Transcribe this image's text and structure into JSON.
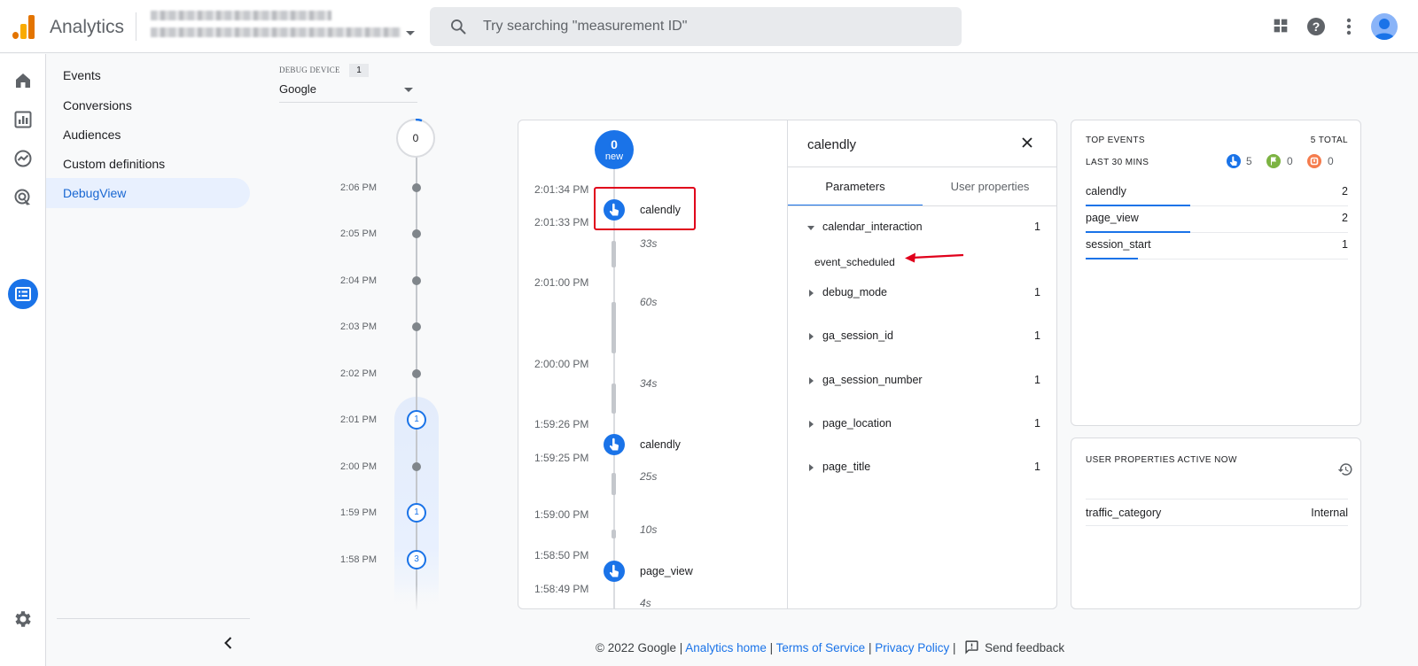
{
  "app": {
    "brand": "Analytics"
  },
  "search": {
    "placeholder": "Try searching \"measurement ID\""
  },
  "topbar": {
    "icons": [
      "apps-icon",
      "help-icon",
      "more-vert-icon",
      "avatar"
    ]
  },
  "rail": {
    "icons": [
      "home-icon",
      "reports-icon",
      "explore-icon",
      "advertising-icon",
      "configure-icon",
      "settings-icon"
    ]
  },
  "nav": {
    "items": [
      {
        "label": "Events"
      },
      {
        "label": "Conversions"
      },
      {
        "label": "Audiences"
      },
      {
        "label": "Custom definitions"
      },
      {
        "label": "DebugView",
        "active": true
      }
    ]
  },
  "debug_device": {
    "label": "DEBUG DEVICE",
    "count": "1",
    "selected": "Google"
  },
  "minutes": {
    "top_count": "0",
    "rows": [
      {
        "time": "2:06 PM",
        "count": null
      },
      {
        "time": "2:05 PM",
        "count": null
      },
      {
        "time": "2:04 PM",
        "count": null
      },
      {
        "time": "2:03 PM",
        "count": null
      },
      {
        "time": "2:02 PM",
        "count": null
      },
      {
        "time": "2:01 PM",
        "count": "1"
      },
      {
        "time": "2:00 PM",
        "count": null
      },
      {
        "time": "1:59 PM",
        "count": "1"
      },
      {
        "time": "1:58 PM",
        "count": "3"
      }
    ]
  },
  "stream": {
    "new_count": "0",
    "new_label": "new",
    "times": [
      "2:01:34 PM",
      "2:01:33 PM",
      "2:01:00 PM",
      "2:00:00 PM",
      "1:59:26 PM",
      "1:59:25 PM",
      "1:59:00 PM",
      "1:58:50 PM",
      "1:58:49 PM"
    ],
    "gaps": [
      "33s",
      "60s",
      "34s",
      "25s",
      "10s",
      "4s"
    ],
    "events": [
      "calendly",
      "calendly",
      "page_view"
    ]
  },
  "event_detail": {
    "title": "calendly",
    "tabs": [
      "Parameters",
      "User properties"
    ],
    "params": [
      {
        "name": "calendar_interaction",
        "count": "1",
        "expanded": true,
        "value": "event_scheduled"
      },
      {
        "name": "debug_mode",
        "count": "1"
      },
      {
        "name": "ga_session_id",
        "count": "1"
      },
      {
        "name": "ga_session_number",
        "count": "1"
      },
      {
        "name": "page_location",
        "count": "1"
      },
      {
        "name": "page_title",
        "count": "1"
      }
    ]
  },
  "top_events": {
    "heading": "TOP EVENTS",
    "total": "5 TOTAL",
    "period": "LAST 30 MINS",
    "stats": [
      {
        "icon": "event-icon",
        "color": "#1a73e8",
        "value": "5"
      },
      {
        "icon": "conversion-flag-icon",
        "color": "#7cb342",
        "value": "0"
      },
      {
        "icon": "error-icon",
        "color": "#f57c4d",
        "value": "0"
      }
    ],
    "rows": [
      {
        "name": "calendly",
        "count": "2",
        "share": 0.4
      },
      {
        "name": "page_view",
        "count": "2",
        "share": 0.4
      },
      {
        "name": "session_start",
        "count": "1",
        "share": 0.2
      }
    ]
  },
  "user_properties": {
    "heading": "USER PROPERTIES ACTIVE NOW",
    "rows": [
      {
        "name": "traffic_category",
        "value": "Internal"
      }
    ]
  },
  "footer": {
    "copyright": "© 2022 Google |",
    "links": [
      "Analytics home",
      "Terms of Service",
      "Privacy Policy"
    ],
    "sep": "|",
    "feedback": "Send feedback"
  },
  "colors": {
    "accent": "#1a73e8",
    "active_nav_bg": "#e8f0fe",
    "highlight": "#e0001b"
  }
}
